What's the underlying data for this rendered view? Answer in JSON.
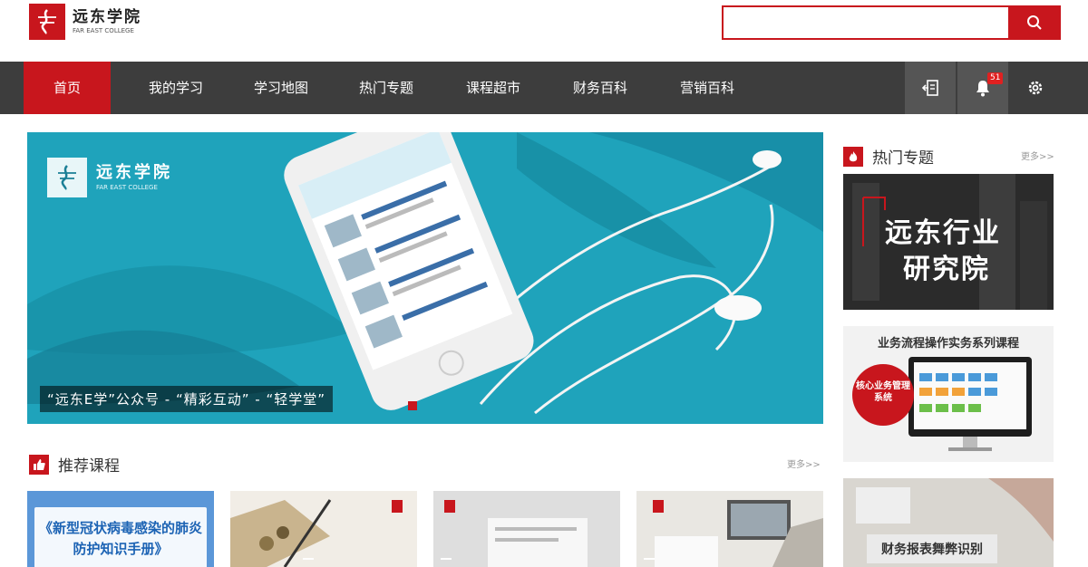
{
  "brand": {
    "name_cn": "远东学院",
    "name_en": "FAR EAST COLLEGE"
  },
  "search": {
    "placeholder": "",
    "value": ""
  },
  "nav": {
    "items": [
      "首页",
      "我的学习",
      "学习地图",
      "热门专题",
      "课程超市",
      "财务百科",
      "营销百科"
    ],
    "notification_count": "51"
  },
  "banner": {
    "logo_cn": "远东学院",
    "logo_en": "FAR EAST COLLEGE",
    "caption": "“远东E学”公众号 - “精彩互动” - “轻学堂”"
  },
  "hot_topics": {
    "title": "热门专题",
    "more": "更多>>",
    "cards": [
      {
        "line1": "远东行业",
        "line2": "研究院"
      },
      {
        "title": "业务流程操作实务系列课程",
        "badge": "核心业务管理系统"
      },
      {
        "label": "财务报表舞弊识别"
      }
    ]
  },
  "recommended": {
    "title": "推荐课程",
    "more": "更多>>",
    "courses": [
      {
        "title": "《新型冠状病毒感染的肺炎防护知识手册》"
      },
      {
        "tag": ""
      },
      {
        "tag": ""
      },
      {
        "tag": ""
      }
    ]
  },
  "colors": {
    "brand_red": "#c8161d",
    "nav_bg": "#3d3d3d",
    "banner_teal": "#1fa3bb"
  }
}
